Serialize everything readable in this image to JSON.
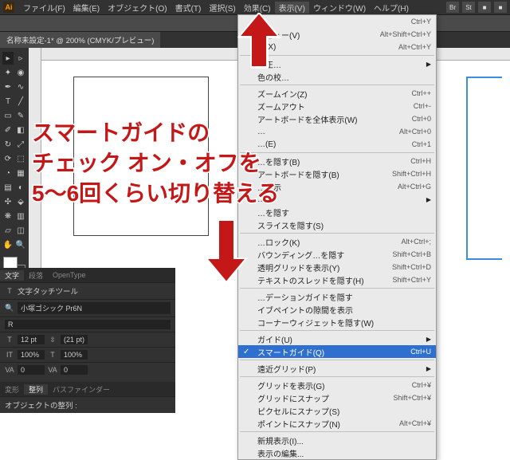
{
  "menubar": {
    "items": [
      "ファイル(F)",
      "編集(E)",
      "オブジェクト(O)",
      "書式(T)",
      "選択(S)",
      "効果(C)",
      "表示(V)",
      "ウィンドウ(W)",
      "ヘルプ(H)"
    ],
    "right_icons": [
      "Br",
      "St",
      "■",
      "■"
    ]
  },
  "doctab": {
    "title": "名称未設定-1* @ 200% (CMYK/プレビュー)"
  },
  "dropdown": {
    "groups": [
      [
        {
          "label": "…",
          "shortcut": "Ctrl+Y"
        },
        {
          "label": "…ビュー(V)",
          "shortcut": "Alt+Shift+Ctrl+Y"
        },
        {
          "label": "…(X)",
          "shortcut": "Alt+Ctrl+Y"
        }
      ],
      [
        {
          "label": "校正…",
          "sub": true
        },
        {
          "label": "色の校…"
        }
      ],
      [
        {
          "label": "ズームイン(Z)",
          "shortcut": "Ctrl++"
        },
        {
          "label": "ズームアウト",
          "shortcut": "Ctrl+-"
        },
        {
          "label": "アートボードを全体表示(W)",
          "shortcut": "Ctrl+0"
        },
        {
          "label": "…",
          "shortcut": "Alt+Ctrl+0"
        },
        {
          "label": "…(E)",
          "shortcut": "Ctrl+1"
        }
      ],
      [
        {
          "label": "…を隠す(B)",
          "shortcut": "Ctrl+H"
        },
        {
          "label": "アートボードを隠す(B)",
          "shortcut": "Shift+Ctrl+H"
        },
        {
          "label": "…表示",
          "shortcut": "Alt+Ctrl+G"
        },
        {
          "label": "…",
          "sub": true
        },
        {
          "label": "…を隠す"
        },
        {
          "label": "スライスを隠す(S)"
        }
      ],
      [
        {
          "label": "…ロック(K)",
          "shortcut": "Alt+Ctrl+;"
        },
        {
          "label": "バウンディング…を隠す",
          "shortcut": "Shift+Ctrl+B"
        },
        {
          "label": "透明グリッドを表示(Y)",
          "shortcut": "Shift+Ctrl+D"
        },
        {
          "label": "テキストのスレッドを隠す(H)",
          "shortcut": "Shift+Ctrl+Y"
        }
      ],
      [
        {
          "label": "…デーションガイドを隠す"
        },
        {
          "label": "イブペイントの隙間を表示"
        },
        {
          "label": "コーナーウィジェットを隠す(W)"
        }
      ],
      [
        {
          "label": "ガイド(U)",
          "sub": true
        },
        {
          "label": "スマートガイド(Q)",
          "shortcut": "Ctrl+U",
          "hl": true,
          "chk": true
        }
      ],
      [
        {
          "label": "遠近グリッド(P)",
          "sub": true
        }
      ],
      [
        {
          "label": "グリッドを表示(G)",
          "shortcut": "Ctrl+¥"
        },
        {
          "label": "グリッドにスナップ",
          "shortcut": "Shift+Ctrl+¥"
        },
        {
          "label": "ピクセルにスナップ(S)"
        },
        {
          "label": "ポイントにスナップ(N)",
          "shortcut": "Alt+Ctrl+¥"
        }
      ],
      [
        {
          "label": "新規表示(I)..."
        },
        {
          "label": "表示の編集..."
        }
      ]
    ]
  },
  "char_panel": {
    "tabs": [
      "文字",
      "段落",
      "OpenType"
    ],
    "touch_tool": "文字タッチツール",
    "font": "小塚ゴシック Pr6N",
    "weight": "R",
    "size": "12 pt",
    "leading": "(21 pt)",
    "vscale": "100%",
    "tracking": "0",
    "kerning": "0",
    "hscale": "100%"
  },
  "transform_panel": {
    "tabs": [
      "変形",
      "整列",
      "パスファインダー"
    ],
    "label": "オブジェクトの整列 :"
  },
  "annotation": {
    "line1": "スマートガイドの",
    "line2": "チェック オン・オフを",
    "line3": "5〜6回くらい切り替える"
  }
}
